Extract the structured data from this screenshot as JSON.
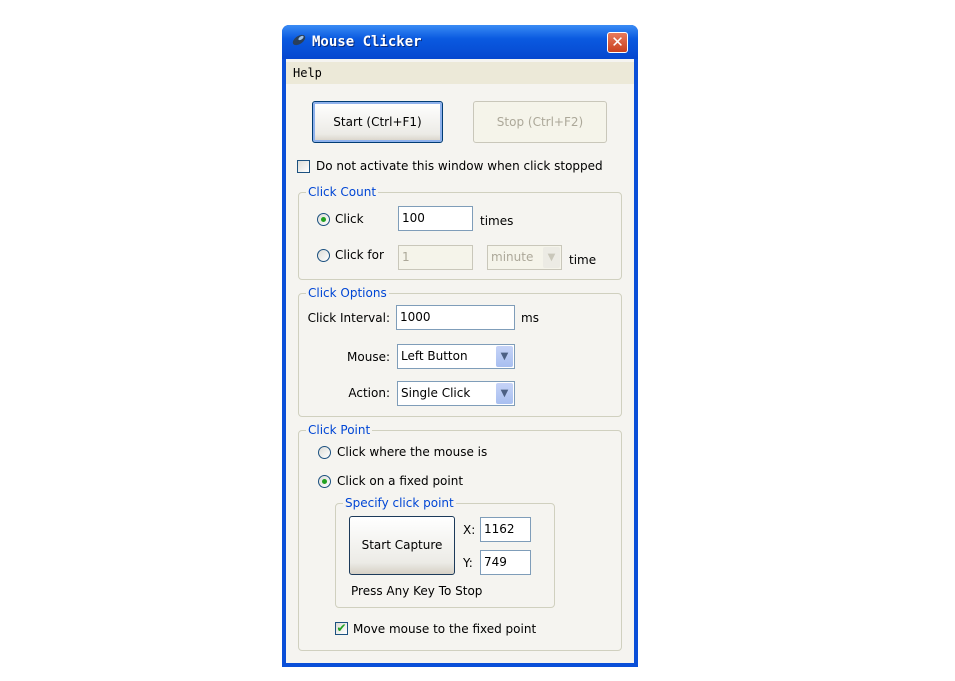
{
  "window": {
    "title": "Mouse Clicker",
    "close_icon": "close-icon",
    "app_icon": "mouse-icon"
  },
  "menu": {
    "help": "Help"
  },
  "buttons": {
    "start": "Start (Ctrl+F1)",
    "stop": "Stop (Ctrl+F2)"
  },
  "no_activate": {
    "label": "Do not activate this window when click stopped",
    "checked": false
  },
  "click_count": {
    "legend": "Click Count",
    "click_label": "Click",
    "click_value": "100",
    "times_label": "times",
    "click_selected": true,
    "click_for_label": "Click for",
    "click_for_value": "1",
    "unit": "minute",
    "time_label": "time",
    "click_for_selected": false
  },
  "click_options": {
    "legend": "Click Options",
    "interval_label": "Click Interval:",
    "interval_value": "1000",
    "ms_label": "ms",
    "mouse_label": "Mouse:",
    "mouse_value": "Left Button",
    "action_label": "Action:",
    "action_value": "Single Click"
  },
  "click_point": {
    "legend": "Click Point",
    "where_mouse": "Click where the mouse is",
    "where_mouse_selected": false,
    "fixed_point": "Click on a fixed point",
    "fixed_point_selected": true,
    "specify": {
      "legend": "Specify click point",
      "capture": "Start Capture",
      "x_label": "X:",
      "x_value": "1162",
      "y_label": "Y:",
      "y_value": "749",
      "hint": "Press Any Key To Stop"
    },
    "move_mouse": {
      "label": "Move mouse to the fixed point",
      "checked": true
    }
  },
  "colors": {
    "titlebar": "#0a5ae0",
    "legend": "#0046d5",
    "check": "#21a121"
  }
}
